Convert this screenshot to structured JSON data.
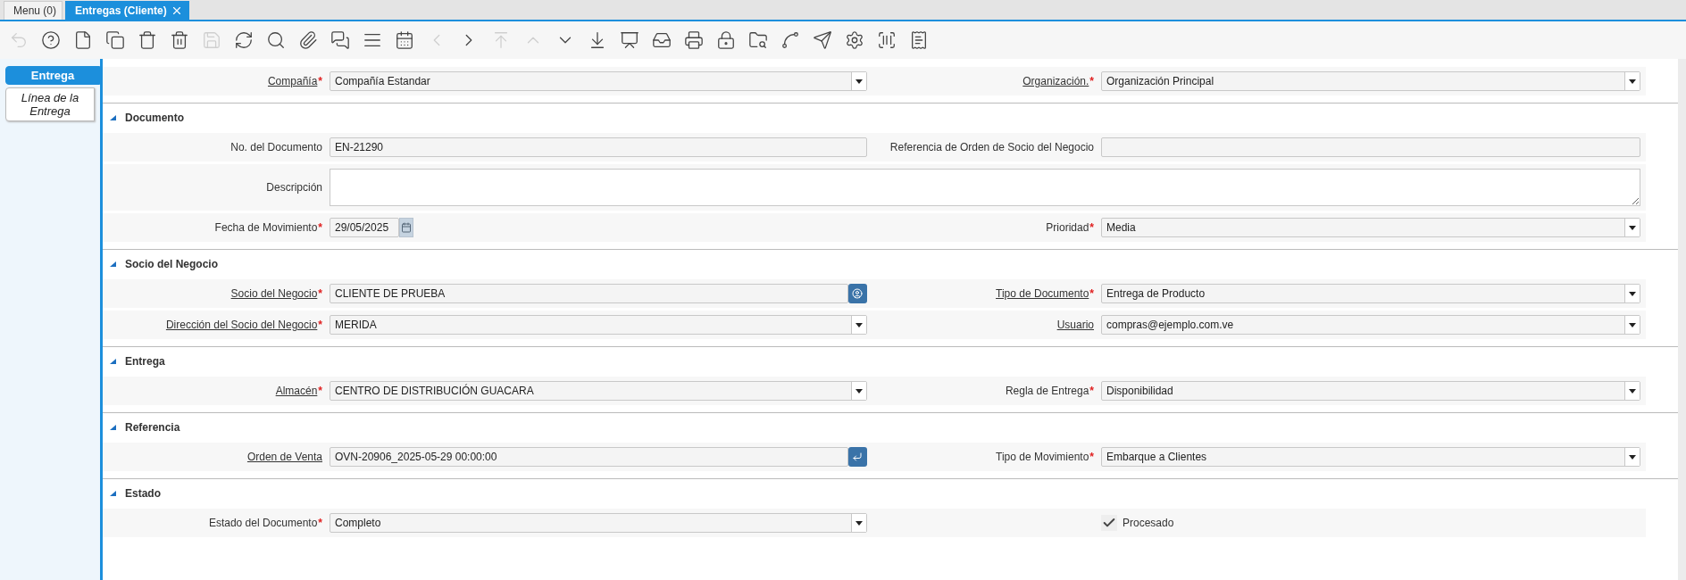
{
  "tabs": [
    {
      "label": "Menu (0)",
      "selected": false,
      "closable": false
    },
    {
      "label": "Entregas (Cliente)",
      "selected": true,
      "closable": true
    }
  ],
  "toolbar": [
    {
      "kind": "undo",
      "disabled": true
    },
    {
      "kind": "help",
      "disabled": false
    },
    {
      "kind": "new",
      "disabled": false
    },
    {
      "kind": "copy",
      "disabled": false
    },
    {
      "kind": "delete",
      "disabled": false
    },
    {
      "kind": "delete-multi",
      "disabled": false
    },
    {
      "kind": "save",
      "disabled": true
    },
    {
      "kind": "refresh",
      "disabled": false
    },
    {
      "kind": "search",
      "disabled": false
    },
    {
      "kind": "attach",
      "disabled": false
    },
    {
      "kind": "chat",
      "disabled": false
    },
    {
      "kind": "grid",
      "disabled": false
    },
    {
      "kind": "calendar",
      "disabled": false
    },
    {
      "kind": "previous",
      "disabled": true
    },
    {
      "kind": "next",
      "disabled": false
    },
    {
      "kind": "first",
      "disabled": true
    },
    {
      "kind": "parent",
      "disabled": true
    },
    {
      "kind": "detail",
      "disabled": false
    },
    {
      "kind": "last",
      "disabled": false
    },
    {
      "kind": "report",
      "disabled": false
    },
    {
      "kind": "archive",
      "disabled": false
    },
    {
      "kind": "print",
      "disabled": false
    },
    {
      "kind": "lock",
      "disabled": false
    },
    {
      "kind": "zoom-across",
      "disabled": false
    },
    {
      "kind": "workflow",
      "disabled": false
    },
    {
      "kind": "send",
      "disabled": false
    },
    {
      "kind": "process",
      "disabled": false
    },
    {
      "kind": "barcode",
      "disabled": false
    },
    {
      "kind": "receipt",
      "disabled": false
    }
  ],
  "side_tabs": [
    {
      "label": "Entrega",
      "selected": true
    },
    {
      "label": "Línea de la Entrega",
      "selected": false
    }
  ],
  "header_rows": [
    [
      {
        "kind": "select",
        "label": "Compañía",
        "required_mark": "*",
        "linked": true,
        "value": "Compañía Estandar"
      },
      {
        "kind": "select",
        "label": "Organización.",
        "required_mark": "*",
        "linked": true,
        "value": "Organización Principal"
      }
    ]
  ],
  "sections": [
    {
      "title": "Documento",
      "rows": [
        [
          {
            "kind": "text",
            "label": "No. del Documento",
            "linked": false,
            "value": "EN-21290"
          },
          {
            "kind": "text",
            "label": "Referencia de Orden de Socio del Negocio",
            "linked": false
          }
        ],
        [
          {
            "kind": "textarea",
            "label": "Descripción",
            "linked": false
          }
        ],
        [
          {
            "kind": "date",
            "label": "Fecha de Movimiento",
            "required_mark": "*",
            "linked": false,
            "value": "29/05/2025"
          },
          {
            "kind": "select",
            "label": "Prioridad",
            "required_mark": "*",
            "linked": false,
            "value": "Media"
          }
        ]
      ]
    },
    {
      "title": "Socio del Negocio",
      "rows": [
        [
          {
            "kind": "search",
            "label": "Socio del Negocio",
            "required_mark": "*",
            "linked": true,
            "value": "CLIENTE DE PRUEBA"
          },
          {
            "kind": "select",
            "label": "Tipo de Documento",
            "required_mark": "*",
            "linked": true,
            "value": "Entrega de Producto"
          }
        ],
        [
          {
            "kind": "select",
            "label": "Dirección del Socio del Negocio",
            "required_mark": "*",
            "linked": true,
            "value": "MERIDA"
          },
          {
            "kind": "select",
            "label": "Usuario",
            "linked": true,
            "value": "compras@ejemplo.com.ve"
          }
        ]
      ]
    },
    {
      "title": "Entrega",
      "rows": [
        [
          {
            "kind": "select",
            "label": "Almacén",
            "required_mark": "*",
            "linked": true,
            "value": "CENTRO DE DISTRIBUCIÓN GUACARA"
          },
          {
            "kind": "select",
            "label": "Regla de Entrega",
            "required_mark": "*",
            "linked": false,
            "value": "Disponibilidad"
          }
        ]
      ]
    },
    {
      "title": "Referencia",
      "rows": [
        [
          {
            "kind": "lookup",
            "label": "Orden de Venta",
            "linked": true,
            "value": "OVN-20906_2025-05-29 00:00:00"
          },
          {
            "kind": "select",
            "label": "Tipo de Movimiento",
            "required_mark": "*",
            "linked": false,
            "value": "Embarque a Clientes"
          }
        ]
      ]
    },
    {
      "title": "Estado",
      "rows": [
        [
          {
            "kind": "select",
            "label": "Estado del Documento",
            "required_mark": "*",
            "linked": false,
            "value": "Completo"
          },
          {
            "kind": "checkbox",
            "label": "Procesado",
            "checked": true
          }
        ]
      ]
    }
  ]
}
